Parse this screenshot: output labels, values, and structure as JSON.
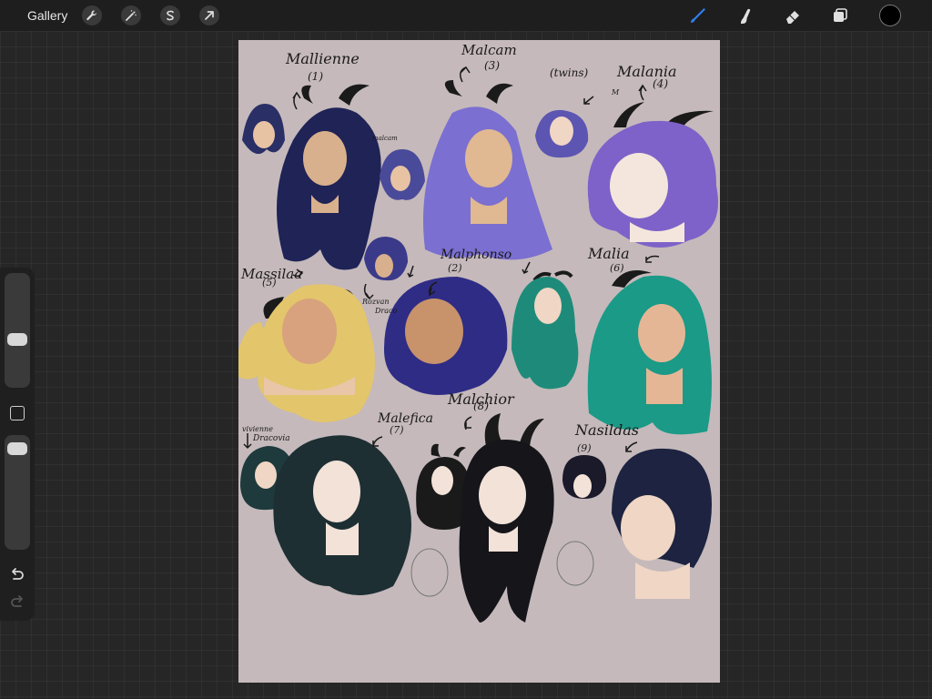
{
  "toolbar": {
    "gallery_label": "Gallery",
    "left_tools": [
      "wrench-icon",
      "magic-wand-icon",
      "selection-icon",
      "transform-arrow-icon"
    ],
    "right_tools": [
      "brush-icon",
      "smudge-icon",
      "eraser-icon",
      "layers-icon"
    ],
    "active_tool": "brush-icon",
    "current_color": "#000000",
    "accent": "#2f7ff0"
  },
  "sidebar": {
    "brush_size_slider_value": 0.58,
    "opacity_slider_value": 0.9,
    "undo_icon": "undo-icon",
    "redo_icon": "redo-icon"
  },
  "canvas": {
    "background": "#c5b9bb",
    "labels": {
      "mallienne": "Mallienne",
      "mallienne_num": "(1)",
      "malcam": "Malcam",
      "malcam_num": "(3)",
      "twins": "(twins)",
      "m": "M",
      "malcam_small": "malcam",
      "malania": "Malania",
      "malania_num": "(4)",
      "massilaa": "Massilaa",
      "massilaa_num": "(5)",
      "rozvan": "Rozvan",
      "dracco": "Draco",
      "malphonso": "Malphonso",
      "malphonso_num": "(2)",
      "malia": "Malia",
      "malia_num": "(6)",
      "vivienne": "vivienne",
      "dracovia": "Dracovia",
      "malefica": "Malefica",
      "malefica_num": "(7)",
      "malchior": "Malchior",
      "malchior_num": "(8)",
      "nasildas": "Nasildas",
      "nasildas_num": "(9)"
    }
  }
}
